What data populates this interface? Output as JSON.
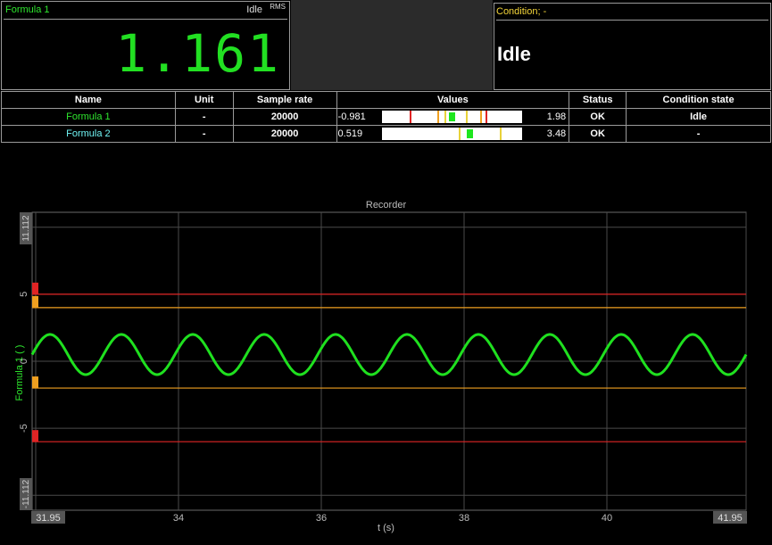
{
  "meter": {
    "title": "Formula 1",
    "mode": "Idle",
    "rms": "RMS",
    "value": "1.161"
  },
  "condition": {
    "title": "Condition; -",
    "state": "Idle"
  },
  "table": {
    "headers": [
      "Name",
      "Unit",
      "Sample rate",
      "Values",
      "Status",
      "Condition state"
    ],
    "rows": [
      {
        "name": "Formula 1",
        "unit": "-",
        "rate": "20000",
        "min": "-0.981",
        "max": "1.98",
        "status": "OK",
        "cond": "Idle"
      },
      {
        "name": "Formula 2",
        "unit": "-",
        "rate": "20000",
        "min": "0.519",
        "max": "3.48",
        "status": "OK",
        "cond": "-"
      }
    ]
  },
  "recorder": {
    "title": "Recorder",
    "ylabel": "Formula 1 ( )",
    "xlabel": "t (s)",
    "ymax_label": "11.112",
    "ymin_label": "-11.112",
    "xmin_label": "31.95",
    "xmax_label": "41.95",
    "yticks": [
      "5",
      "0",
      "-5"
    ],
    "xticks": [
      "34",
      "36",
      "38",
      "40"
    ],
    "colors": {
      "signal": "#1fe01f",
      "alarm": "#e02424",
      "warning": "#f0a020",
      "grid": "#4a4a4a"
    }
  },
  "chart_data": {
    "type": "line",
    "title": "Recorder",
    "xlabel": "t (s)",
    "ylabel": "Formula 1 ( )",
    "xlim": [
      31.95,
      41.95
    ],
    "ylim": [
      -11.112,
      11.112
    ],
    "grid": true,
    "limit_lines": [
      {
        "level": "alarm",
        "y": 5
      },
      {
        "level": "warning",
        "y": 4
      },
      {
        "level": "warning",
        "y": -2
      },
      {
        "level": "alarm",
        "y": -6
      }
    ],
    "series": [
      {
        "name": "Formula 1",
        "waveform": "sine",
        "offset": 0.5,
        "amplitude": 1.5,
        "cycles_visible": 10
      }
    ]
  }
}
